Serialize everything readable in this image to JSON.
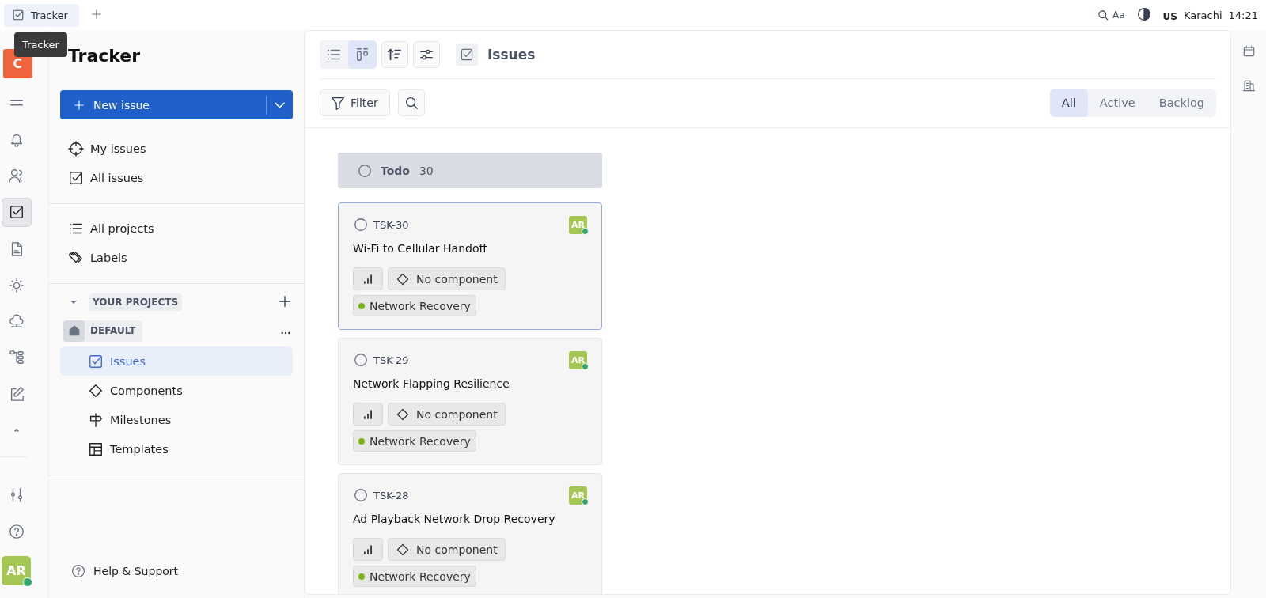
{
  "top_bar": {
    "tabs": [
      {
        "label": "Tracker",
        "selected": true
      }
    ],
    "right": {
      "font_label": "Aa",
      "language": "US",
      "city": "Karachi",
      "time": "14:21"
    }
  },
  "tooltip": "Tracker",
  "rail": {
    "logo": "C",
    "items": [
      {
        "kind": "menu",
        "selected": false
      },
      {
        "kind": "bell",
        "selected": false
      },
      {
        "kind": "people",
        "selected": false
      },
      {
        "kind": "check",
        "selected": true
      },
      {
        "kind": "doc",
        "selected": false
      },
      {
        "kind": "sun",
        "selected": false
      },
      {
        "kind": "cloud",
        "selected": false
      },
      {
        "kind": "tree",
        "selected": false
      },
      {
        "kind": "edit",
        "selected": false
      },
      {
        "kind": "caret",
        "selected": false
      }
    ],
    "bottom": [
      {
        "kind": "sliders"
      },
      {
        "kind": "help"
      }
    ],
    "avatar": "AR",
    "online": true
  },
  "sidebar": {
    "title": "Tracker",
    "new_button": "New issue",
    "groups": [
      [
        {
          "kind": "target",
          "label": "My issues",
          "selected": false
        },
        {
          "kind": "check",
          "label": "All issues",
          "selected": false
        }
      ],
      [
        {
          "kind": "list",
          "label": "All projects",
          "selected": false
        },
        {
          "kind": "tags",
          "label": "Labels",
          "selected": false
        }
      ]
    ],
    "section": "YOUR PROJECTS",
    "project": "DEFAULT",
    "project_items": [
      {
        "kind": "check",
        "label": "Issues",
        "selected": true
      },
      {
        "kind": "diamond",
        "label": "Components",
        "selected": false
      },
      {
        "kind": "sign",
        "label": "Milestones",
        "selected": false
      },
      {
        "kind": "layout",
        "label": "Templates",
        "selected": false
      }
    ],
    "help": "Help & Support"
  },
  "main": {
    "views": [
      {
        "kind": "list",
        "selected": false
      },
      {
        "kind": "board",
        "selected": true
      }
    ],
    "title": "Issues",
    "filter": "Filter",
    "segments": [
      {
        "label": "All",
        "selected": true
      },
      {
        "label": "Active",
        "selected": false
      },
      {
        "label": "Backlog",
        "selected": false
      }
    ],
    "column": {
      "name": "Todo",
      "count": "30"
    },
    "cards": [
      {
        "id": "TSK-30",
        "title": "Wi-Fi to Cellular Handoff",
        "selected": true,
        "assignee": "AR",
        "online": true,
        "component": "No component",
        "label": {
          "text": "Network Recovery",
          "color": "#7cb518"
        }
      },
      {
        "id": "TSK-29",
        "title": "Network Flapping Resilience",
        "selected": false,
        "assignee": "AR",
        "online": true,
        "component": "No component",
        "label": {
          "text": "Network Recovery",
          "color": "#7cb518"
        }
      },
      {
        "id": "TSK-28",
        "title": "Ad Playback Network Drop Recovery",
        "selected": false,
        "assignee": "AR",
        "online": true,
        "component": "No component",
        "label": {
          "text": "Network Recovery",
          "color": "#7cb518"
        }
      }
    ]
  }
}
